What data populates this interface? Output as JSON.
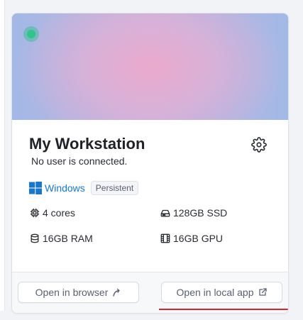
{
  "workstation": {
    "name": "My Workstation",
    "status_text": "No user is connected.",
    "status_color": "#31c58c",
    "os": {
      "name": "Windows",
      "icon": "windows-logo-icon",
      "badge": "Persistent"
    },
    "specs": {
      "cores": "4 cores",
      "storage": "128GB SSD",
      "ram": "16GB RAM",
      "gpu": "16GB GPU"
    }
  },
  "actions": {
    "open_browser_label": "Open in browser",
    "open_local_label": "Open in local app"
  },
  "colors": {
    "accent_link": "#1877c9",
    "highlight_underline": "#d8232a"
  }
}
